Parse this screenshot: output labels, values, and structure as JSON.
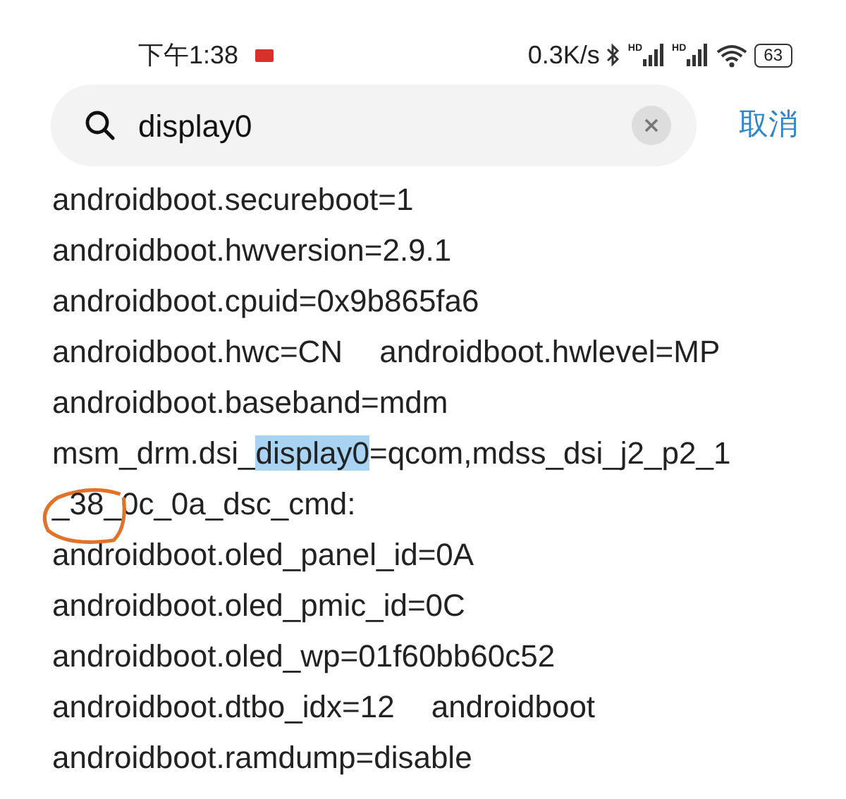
{
  "status_bar": {
    "time": "下午1:38",
    "speed": "0.3K/s",
    "signals": [
      {
        "label": "HD"
      },
      {
        "label": "HD"
      }
    ],
    "battery": "63"
  },
  "search": {
    "value": "display0",
    "cancel": "取消"
  },
  "lines": [
    {
      "entries": [
        {
          "segments": [
            {
              "text": "androidboot.secureboot=1",
              "highlighted": false,
              "circled": false
            }
          ]
        }
      ]
    },
    {
      "entries": [
        {
          "segments": [
            {
              "text": "androidboot.hwversion=2.9.1",
              "highlighted": false,
              "circled": false
            }
          ]
        }
      ]
    },
    {
      "entries": [
        {
          "segments": [
            {
              "text": "androidboot.cpuid=0x9b865fa6",
              "highlighted": false,
              "circled": false
            }
          ]
        }
      ]
    },
    {
      "entries": [
        {
          "segments": [
            {
              "text": "androidboot.hwc=CN",
              "highlighted": false,
              "circled": false
            }
          ]
        },
        {
          "segments": [
            {
              "text": "androidboot.hwlevel=MP",
              "highlighted": false,
              "circled": false
            }
          ]
        }
      ]
    },
    {
      "entries": [
        {
          "segments": [
            {
              "text": "androidboot.baseband=mdm",
              "highlighted": false,
              "circled": false
            }
          ]
        }
      ]
    },
    {
      "entries": [
        {
          "segments": [
            {
              "text": "msm_drm.dsi_",
              "highlighted": false,
              "circled": false
            },
            {
              "text": "display0",
              "highlighted": true,
              "circled": false
            },
            {
              "text": "=qcom,mdss_dsi_j2_p2_1",
              "highlighted": false,
              "circled": false
            }
          ]
        }
      ]
    },
    {
      "entries": [
        {
          "segments": [
            {
              "text": "_38_",
              "highlighted": false,
              "circled": true
            },
            {
              "text": "0c_0a_dsc_cmd:",
              "highlighted": false,
              "circled": false
            }
          ]
        }
      ]
    },
    {
      "entries": [
        {
          "segments": [
            {
              "text": "androidboot.oled_panel_id=0A",
              "highlighted": false,
              "circled": false
            }
          ]
        }
      ]
    },
    {
      "entries": [
        {
          "segments": [
            {
              "text": "androidboot.oled_pmic_id=0C",
              "highlighted": false,
              "circled": false
            }
          ]
        }
      ]
    },
    {
      "entries": [
        {
          "segments": [
            {
              "text": "androidboot.oled_wp=01f60bb60c52",
              "highlighted": false,
              "circled": false
            }
          ]
        }
      ]
    },
    {
      "entries": [
        {
          "segments": [
            {
              "text": "androidboot.dtbo_idx=12",
              "highlighted": false,
              "circled": false
            }
          ]
        },
        {
          "segments": [
            {
              "text": "androidboot",
              "highlighted": false,
              "circled": false
            }
          ]
        }
      ]
    },
    {
      "entries": [
        {
          "segments": [
            {
              "text": "androidboot.ramdump=disable",
              "highlighted": false,
              "circled": false
            }
          ]
        }
      ]
    }
  ]
}
